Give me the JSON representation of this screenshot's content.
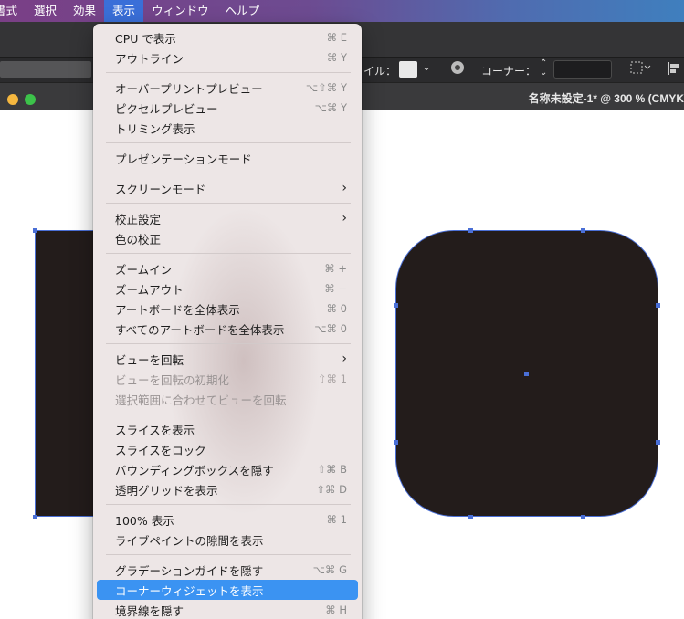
{
  "menubar": {
    "items": [
      "書式",
      "選択",
      "効果",
      "表示",
      "ウィンドウ",
      "ヘルプ"
    ],
    "active_index": 3,
    "active_color": "#3a6fd8"
  },
  "control_bar": {
    "fill_label": "イル：",
    "corner_label": "コーナー：",
    "corner_stepper": "⌃⌄",
    "chevron": "⌄"
  },
  "document": {
    "title": "名称未設定-1* @ 300 % (CMYK",
    "traffic_colors": [
      "#f5b73f",
      "#3cc24a"
    ]
  },
  "view_menu": {
    "groups": [
      [
        {
          "label": "CPU で表示",
          "shortcut": "⌘ E"
        },
        {
          "label": "アウトライン",
          "shortcut": "⌘ Y"
        }
      ],
      [
        {
          "label": "オーバープリントプレビュー",
          "shortcut": "⌥⇧⌘ Y"
        },
        {
          "label": "ピクセルプレビュー",
          "shortcut": "⌥⌘ Y"
        },
        {
          "label": "トリミング表示",
          "shortcut": ""
        }
      ],
      [
        {
          "label": "プレゼンテーションモード",
          "shortcut": ""
        }
      ],
      [
        {
          "label": "スクリーンモード",
          "shortcut": "",
          "submenu": true
        }
      ],
      [
        {
          "label": "校正設定",
          "shortcut": "",
          "submenu": true
        },
        {
          "label": "色の校正",
          "shortcut": ""
        }
      ],
      [
        {
          "label": "ズームイン",
          "shortcut": "⌘ +"
        },
        {
          "label": "ズームアウト",
          "shortcut": "⌘ −"
        },
        {
          "label": "アートボードを全体表示",
          "shortcut": "⌘ 0"
        },
        {
          "label": "すべてのアートボードを全体表示",
          "shortcut": "⌥⌘ 0"
        }
      ],
      [
        {
          "label": "ビューを回転",
          "shortcut": "",
          "submenu": true
        },
        {
          "label": "ビューを回転の初期化",
          "shortcut": "⇧⌘ 1",
          "disabled": true
        },
        {
          "label": "選択範囲に合わせてビューを回転",
          "shortcut": "",
          "disabled": true
        }
      ],
      [
        {
          "label": "スライスを表示",
          "shortcut": ""
        },
        {
          "label": "スライスをロック",
          "shortcut": ""
        },
        {
          "label": "バウンディングボックスを隠す",
          "shortcut": "⇧⌘ B"
        },
        {
          "label": "透明グリッドを表示",
          "shortcut": "⇧⌘ D"
        }
      ],
      [
        {
          "label": "100% 表示",
          "shortcut": "⌘ 1"
        },
        {
          "label": "ライブペイントの隙間を表示",
          "shortcut": ""
        }
      ],
      [
        {
          "label": "グラデーションガイドを隠す",
          "shortcut": "⌥⌘ G"
        },
        {
          "label": "コーナーウィジェットを表示",
          "shortcut": "",
          "selected": true
        },
        {
          "label": "境界線を隠す",
          "shortcut": "⌘ H"
        }
      ]
    ],
    "arrow_glyph": "›"
  },
  "colors": {
    "shape_fill": "#231c1b",
    "selection": "#4a6fd6",
    "menu_bg": "#ede6e6",
    "highlight": "#3b93f2"
  }
}
